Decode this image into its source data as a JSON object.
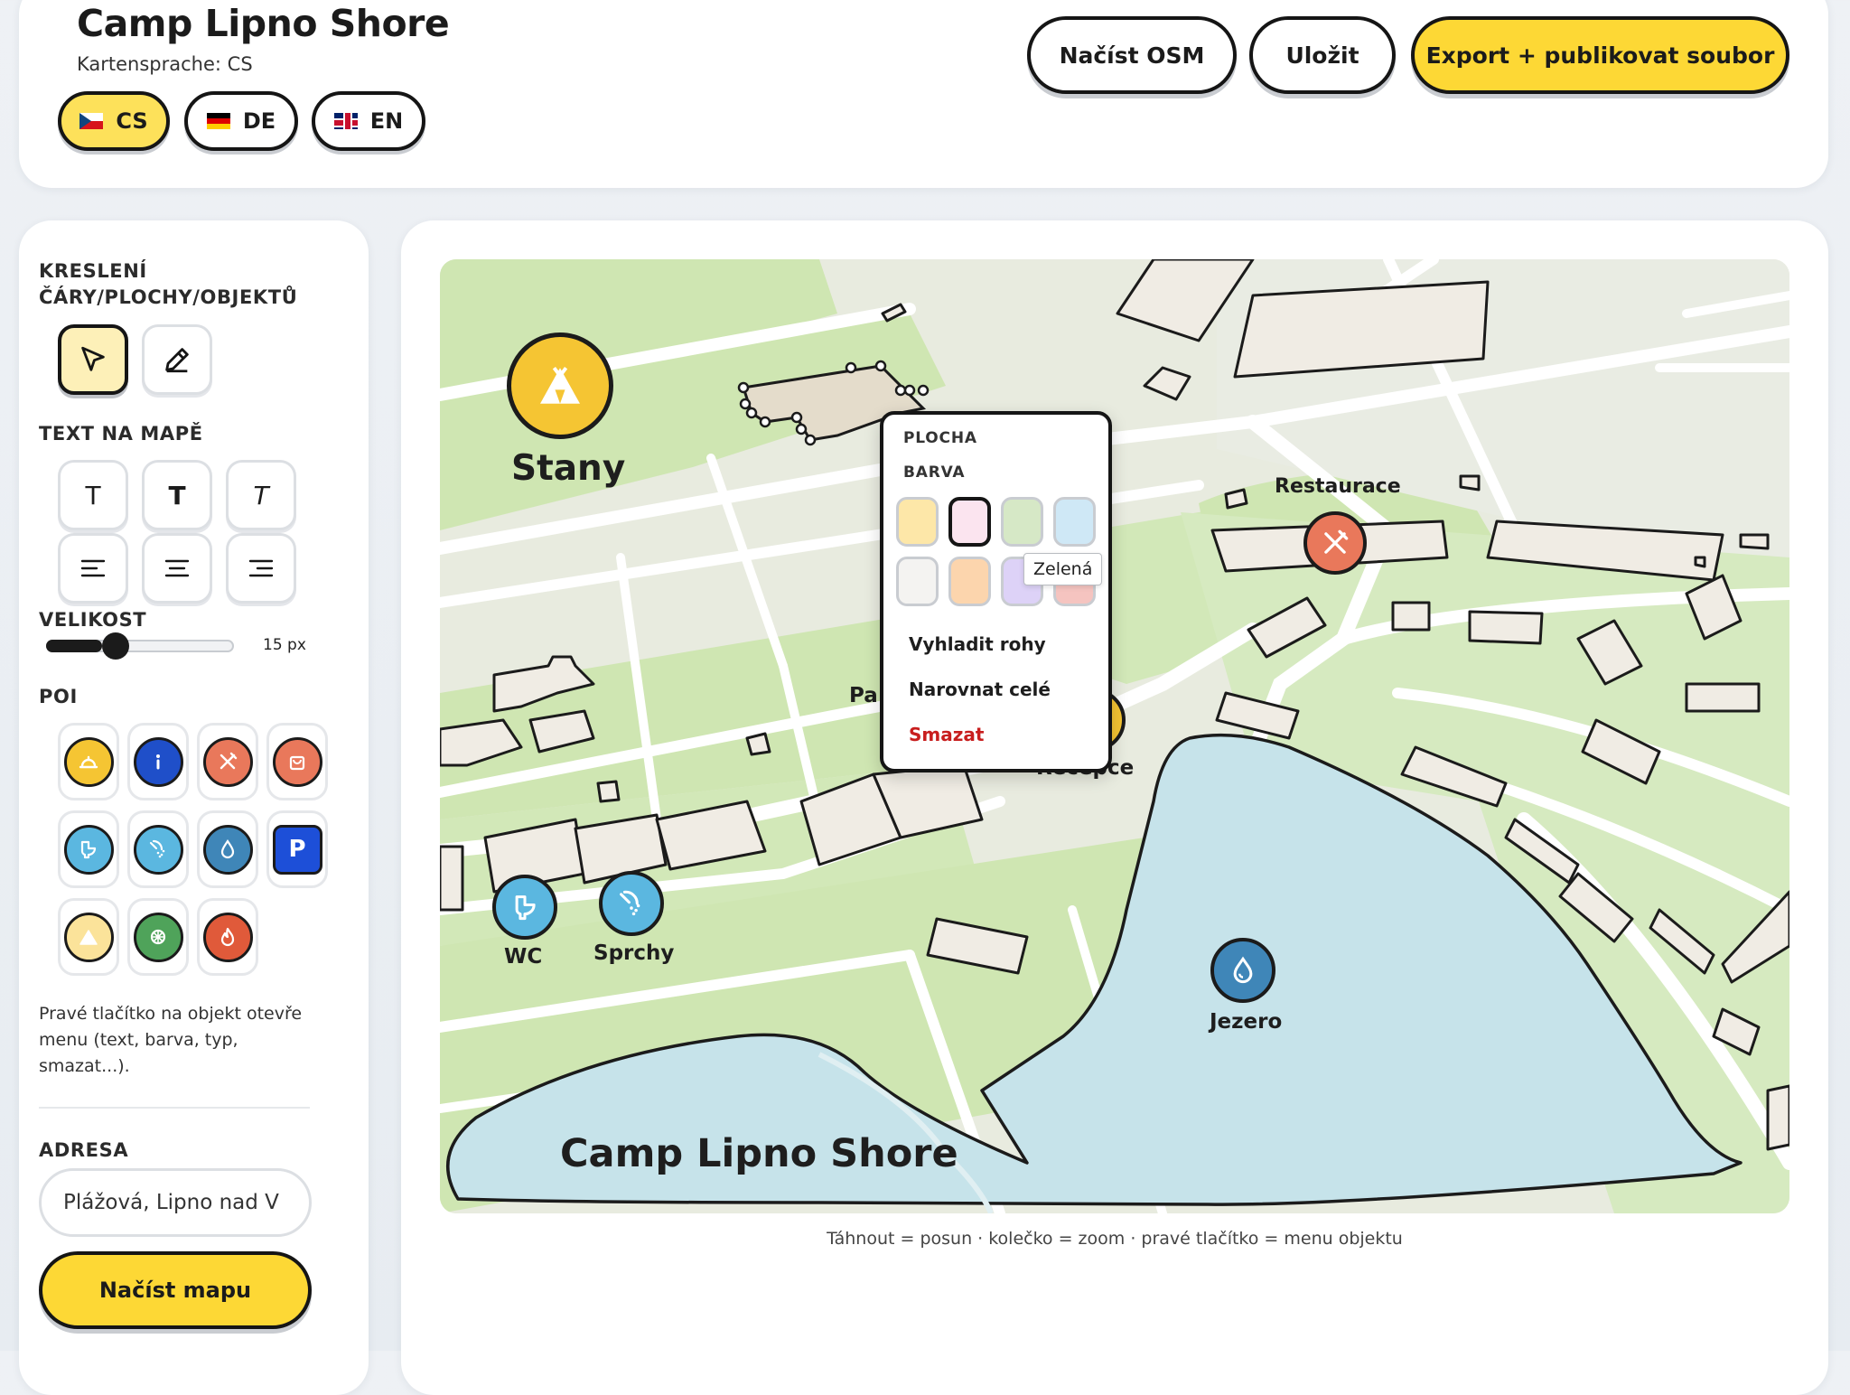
{
  "header": {
    "title": "Camp Lipno Shore",
    "map_language_caption": "Kartensprache: CS",
    "languages": [
      {
        "code": "CS",
        "flag": "flag-cz",
        "active": true
      },
      {
        "code": "DE",
        "flag": "flag-de",
        "active": false
      },
      {
        "code": "EN",
        "flag": "flag-uk",
        "active": false
      }
    ],
    "buttons": {
      "load_osm": "Načíst OSM",
      "save": "Uložit",
      "export": "Export + publikovat soubor"
    }
  },
  "sidebar": {
    "drawing_title": "KRESLENÍ\nČÁRY/PLOCHY/OBJEKTŮ",
    "drawing_tools": [
      {
        "name": "select-tool",
        "icon": "cursor-arrow-icon",
        "active": true
      },
      {
        "name": "draw-tool",
        "icon": "pencil-icon",
        "active": false
      }
    ],
    "text_title": "TEXT NA MAPĚ",
    "text_style_buttons": [
      {
        "glyph": "T",
        "icon": "text-normal-icon"
      },
      {
        "glyph": "T",
        "icon": "text-bold-icon"
      },
      {
        "glyph": "T",
        "icon": "text-italic-icon"
      }
    ],
    "align_buttons": [
      "align-left-icon",
      "align-center-icon",
      "align-right-icon"
    ],
    "size_title": "VELIKOST",
    "size_value": "15 px",
    "size_level": 0.3,
    "poi_title": "POI",
    "poi_items": [
      {
        "icon": "reception-bell-icon",
        "color": "#f5c533"
      },
      {
        "icon": "info-icon",
        "color": "#1f4fc9"
      },
      {
        "icon": "restaurant-icon",
        "color": "#e9785b"
      },
      {
        "icon": "shop-bag-icon",
        "color": "#e9785b"
      },
      {
        "icon": "toilet-icon",
        "color": "#5bb7e0"
      },
      {
        "icon": "shower-icon",
        "color": "#5bb7e0"
      },
      {
        "icon": "water-drop-icon",
        "color": "#3f86b8"
      },
      {
        "icon": "parking-icon",
        "color": "#1d4fd8"
      },
      {
        "icon": "tent-icon",
        "color": "#fbe39a"
      },
      {
        "icon": "playground-icon",
        "color": "#4fa35a"
      },
      {
        "icon": "fire-icon",
        "color": "#e05a3a"
      }
    ],
    "parking_glyph": "P",
    "hint": "Pravé tlačítko na objekt otevře menu (text, barva, typ, smazat...).",
    "address_title": "ADRESA",
    "address_value": "Plážová, Lipno nad V",
    "load_map_button": "Načíst mapu"
  },
  "map": {
    "labels": {
      "stany": "Stany",
      "restaurace": "Restaurace",
      "wc": "WC",
      "sprchy": "Sprchy",
      "jezero": "Jezero",
      "camp_name": "Camp Lipno Shore",
      "partial_pa": "Pa",
      "partial_recepce": "Recepce"
    },
    "colors": {
      "green": "#cfe6b2",
      "road": "#ffffff",
      "building": "#f0ece4",
      "water": "#c6e3ea"
    },
    "help_text": "Táhnout = posun · kolečko = zoom · pravé tlačítko = menu objektu"
  },
  "context_menu": {
    "section": "PLOCHA",
    "color_label": "BARVA",
    "swatches": [
      {
        "color": "#fde7a8",
        "selected": false
      },
      {
        "color": "#fbe4ef",
        "selected": true
      },
      {
        "color": "#d6e8c6",
        "selected": false
      },
      {
        "color": "#cfe8f6",
        "selected": false
      },
      {
        "color": "#f4f3f1",
        "selected": false
      },
      {
        "color": "#fcd5ad",
        "selected": false
      },
      {
        "color": "#ddd2f7",
        "selected": false
      },
      {
        "color": "#f5c4c0",
        "selected": false
      }
    ],
    "tooltip": "Zelená",
    "items": {
      "smooth": "Vyhladit rohy",
      "straighten": "Narovnat celé",
      "delete": "Smazat"
    }
  }
}
